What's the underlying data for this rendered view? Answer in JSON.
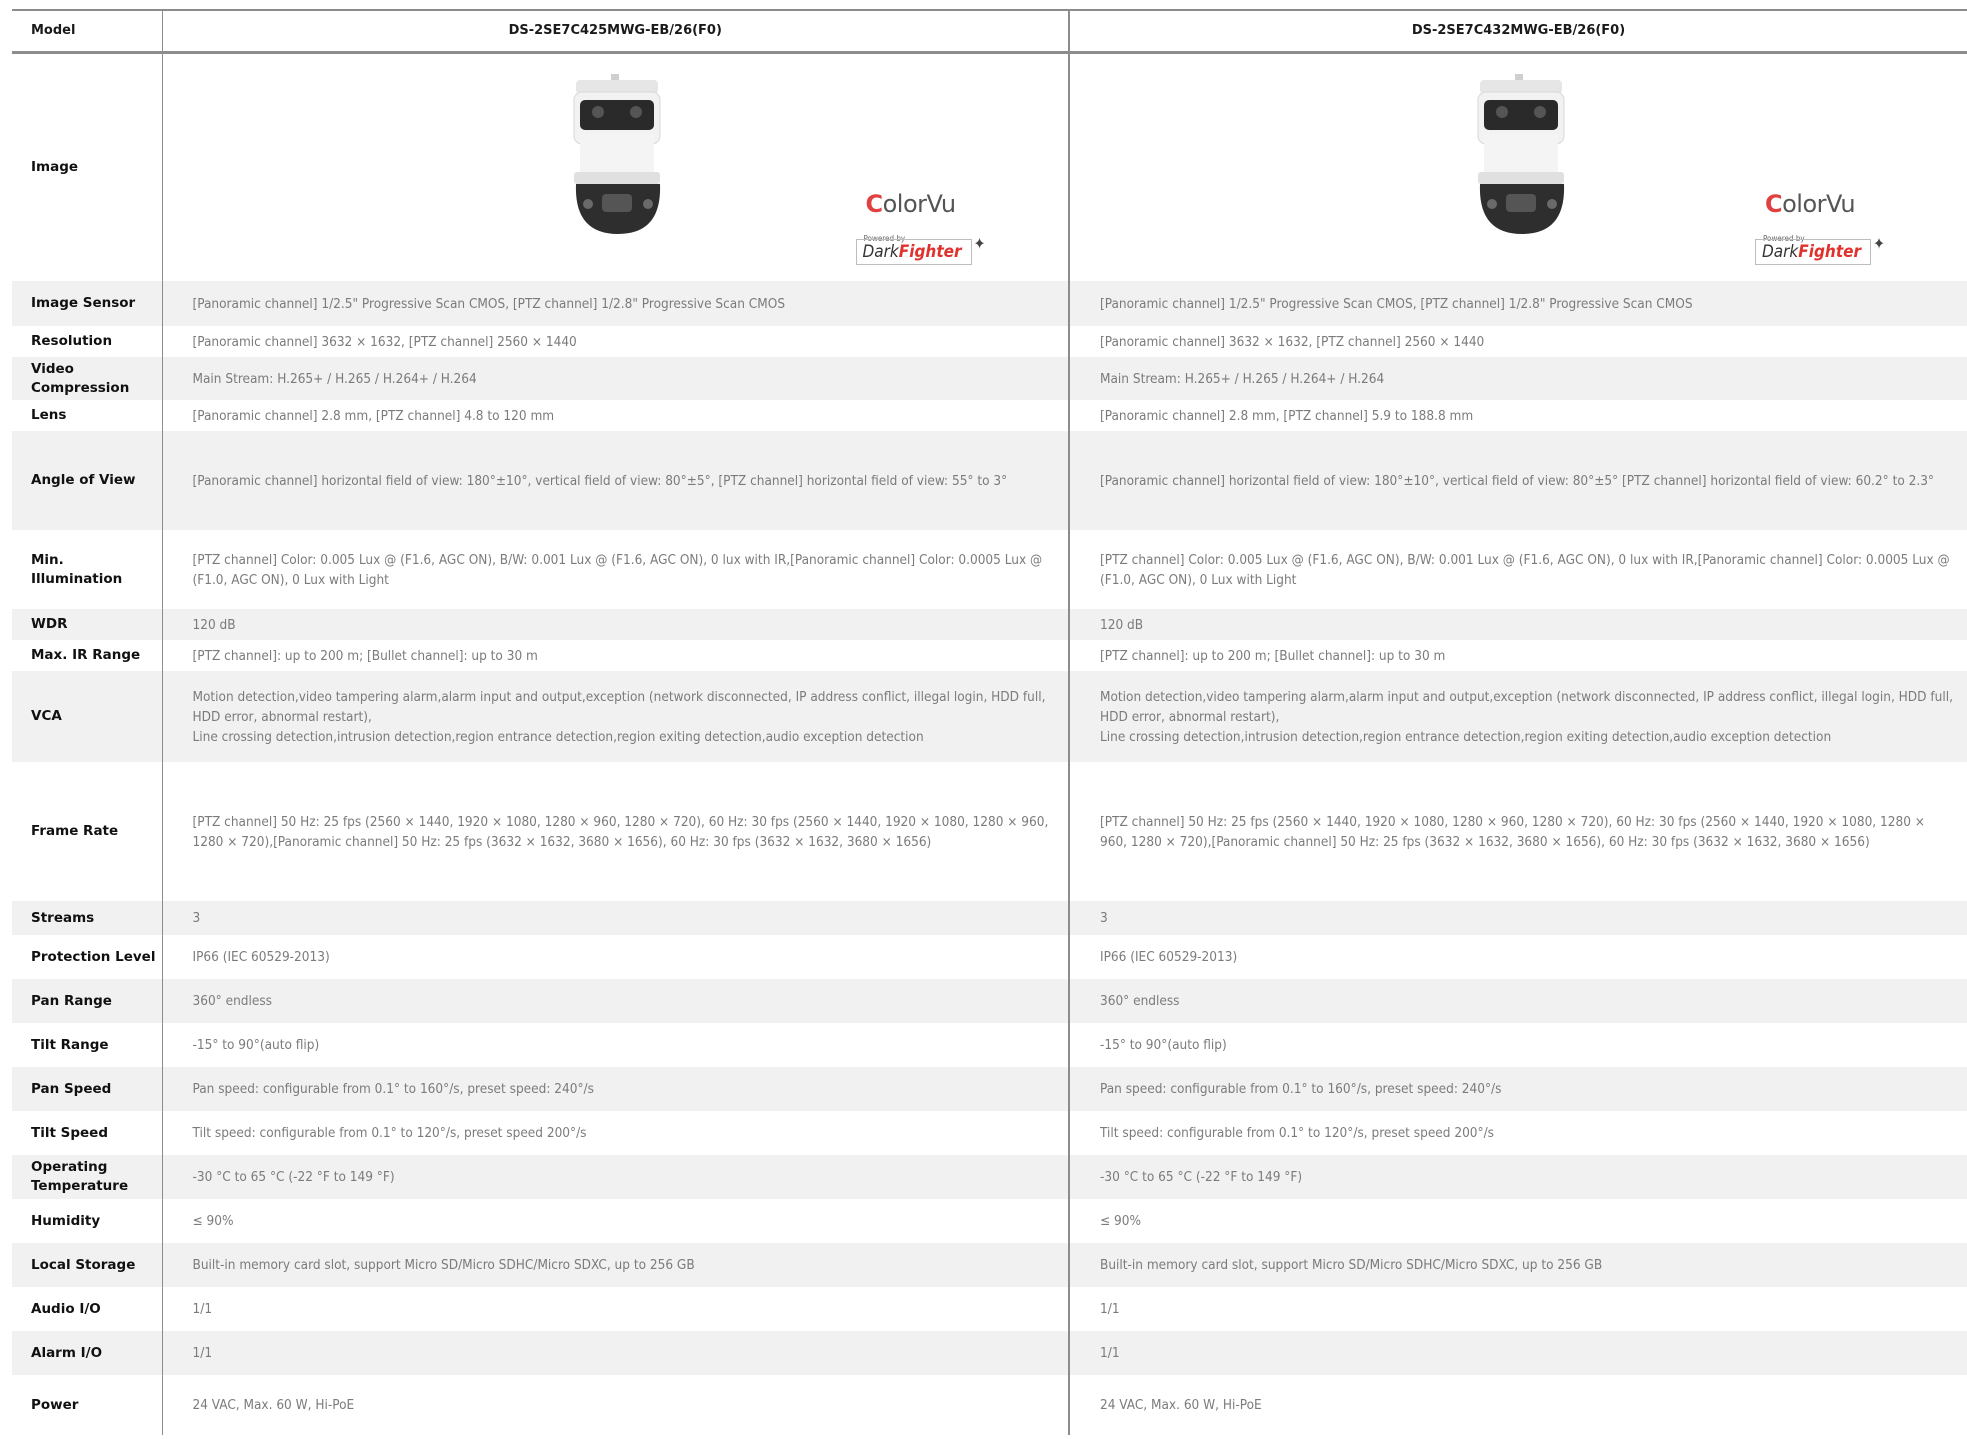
{
  "header": {
    "label": "Model",
    "models": [
      "DS-2SE7C425MWG-EB/26(F0)",
      "DS-2SE7C432MWG-EB/26(F0)"
    ]
  },
  "image_row": {
    "label": "Image",
    "badge": {
      "brand": "ColorVu",
      "powered_by": "Powered by",
      "tech_dark": "Dark",
      "tech_fighter": "Fighter"
    }
  },
  "rows": [
    {
      "label": "Image Sensor",
      "v1": "[Panoramic channel] 1/2.5\" Progressive Scan CMOS, [PTZ channel] 1/2.8\" Progressive Scan CMOS",
      "v2": "[Panoramic channel] 1/2.5\" Progressive Scan CMOS, [PTZ channel] 1/2.8\" Progressive Scan CMOS"
    },
    {
      "label": "Resolution",
      "v1": "[Panoramic channel] 3632 × 1632, [PTZ channel] 2560 × 1440",
      "v2": "[Panoramic channel] 3632 × 1632, [PTZ channel] 2560 × 1440"
    },
    {
      "label": "Video Compression",
      "v1": "Main Stream: H.265+ / H.265 / H.264+ / H.264",
      "v2": "Main Stream: H.265+ / H.265 / H.264+ / H.264"
    },
    {
      "label": "Lens",
      "v1": "[Panoramic channel] 2.8 mm, [PTZ channel] 4.8 to 120 mm",
      "v2": "[Panoramic channel] 2.8 mm, [PTZ channel] 5.9 to 188.8 mm"
    },
    {
      "label": "Angle of View",
      "v1": "[Panoramic channel] horizontal field of view: 180°±10°, vertical field of view: 80°±5°, [PTZ channel] horizontal field of view: 55° to 3°",
      "v2": "[Panoramic channel] horizontal field of view: 180°±10°, vertical field of view: 80°±5° [PTZ channel] horizontal field of view: 60.2° to 2.3°"
    },
    {
      "label": "Min. Illumination",
      "v1": "[PTZ channel] Color: 0.005 Lux @ (F1.6, AGC ON), B/W: 0.001 Lux @ (F1.6, AGC ON), 0 lux with IR,[Panoramic channel] Color: 0.0005 Lux @ (F1.0, AGC ON), 0 Lux with Light",
      "v2": "[PTZ channel] Color: 0.005 Lux @ (F1.6, AGC ON), B/W: 0.001 Lux @ (F1.6, AGC ON), 0 lux with IR,[Panoramic channel] Color: 0.0005 Lux @ (F1.0, AGC ON), 0 Lux with Light"
    },
    {
      "label": "WDR",
      "v1": "120 dB",
      "v2": "120 dB"
    },
    {
      "label": "Max. IR Range",
      "v1": "[PTZ channel]: up to 200 m; [Bullet channel]: up to 30 m",
      "v2": "[PTZ channel]: up to 200 m; [Bullet channel]: up to 30 m"
    },
    {
      "label": "VCA",
      "v1": "Motion detection,video tampering alarm,alarm input and output,exception (network disconnected, IP address conflict, illegal login, HDD full, HDD error, abnormal restart),\nLine crossing detection,intrusion detection,region entrance detection,region exiting detection,audio exception detection",
      "v2": "Motion detection,video tampering alarm,alarm input and output,exception (network disconnected, IP address conflict, illegal login, HDD full, HDD error, abnormal restart),\nLine crossing detection,intrusion detection,region entrance detection,region exiting detection,audio exception detection"
    },
    {
      "label": "Frame Rate",
      "v1": "[PTZ channel] 50 Hz: 25 fps (2560 × 1440, 1920 × 1080, 1280 × 960, 1280 × 720), 60 Hz: 30 fps (2560 × 1440, 1920 × 1080, 1280 × 960, 1280 × 720),[Panoramic channel] 50 Hz: 25 fps (3632 × 1632, 3680 × 1656), 60 Hz: 30 fps (3632 × 1632, 3680 × 1656)",
      "v2": "[PTZ channel] 50 Hz: 25 fps (2560 × 1440, 1920 × 1080, 1280 × 960, 1280 × 720), 60 Hz: 30 fps (2560 × 1440, 1920 × 1080, 1280 × 960, 1280 × 720),[Panoramic channel] 50 Hz: 25 fps (3632 × 1632, 3680 × 1656), 60 Hz: 30 fps (3632 × 1632, 3680 × 1656)"
    },
    {
      "label": "Streams",
      "v1": "3",
      "v2": "3"
    },
    {
      "label": "Protection Level",
      "v1": "IP66 (IEC 60529-2013)",
      "v2": "IP66 (IEC 60529-2013)"
    },
    {
      "label": "Pan Range",
      "v1": "360° endless",
      "v2": "360° endless"
    },
    {
      "label": "Tilt Range",
      "v1": "-15° to 90°(auto flip)",
      "v2": "-15° to 90°(auto flip)"
    },
    {
      "label": "Pan Speed",
      "v1": "Pan speed: configurable from 0.1° to 160°/s, preset speed: 240°/s",
      "v2": "Pan speed: configurable from 0.1° to 160°/s, preset speed: 240°/s"
    },
    {
      "label": "Tilt Speed",
      "v1": "Tilt speed: configurable from 0.1° to 120°/s, preset speed 200°/s",
      "v2": "Tilt speed: configurable from 0.1° to 120°/s, preset speed 200°/s"
    },
    {
      "label": "Operating Temperature",
      "v1": "-30 °C to 65 °C (-22 °F to 149 °F)",
      "v2": "-30 °C to 65 °C (-22 °F to 149 °F)"
    },
    {
      "label": "Humidity",
      "v1": "≤ 90%",
      "v2": "≤ 90%"
    },
    {
      "label": "Local Storage",
      "v1": "Built-in memory card slot, support Micro SD/Micro SDHC/Micro SDXC, up to 256 GB",
      "v2": "Built-in memory card slot, support Micro SD/Micro SDHC/Micro SDXC, up to 256 GB"
    },
    {
      "label": "Audio I/O",
      "v1": "1/1",
      "v2": "1/1"
    },
    {
      "label": "Alarm I/O",
      "v1": "1/1",
      "v2": "1/1"
    },
    {
      "label": "Power",
      "v1": "24 VAC, Max. 60 W, Hi-PoE",
      "v2": "24 VAC, Max. 60 W, Hi-PoE"
    }
  ]
}
